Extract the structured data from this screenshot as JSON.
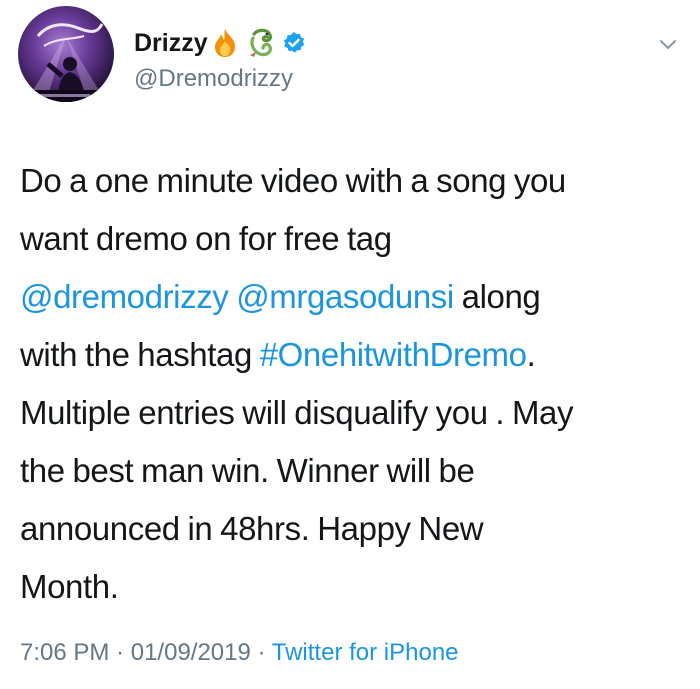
{
  "tweet": {
    "author": {
      "display_name": "Drizzy",
      "handle": "@Dremodrizzy",
      "name_emojis": [
        "fire-emoji",
        "dragon-emoji"
      ],
      "verified": true
    },
    "lines": [
      [
        "Do a one minute video with a song you"
      ],
      [
        "want dremo on for free tag"
      ],
      [
        "@dremodrizzy",
        " ",
        "@mrgasodunsi",
        " along"
      ],
      [
        "with the hashtag ",
        "#OnehitwithDremo",
        "."
      ],
      [
        "Multiple entries will disqualify you . May"
      ],
      [
        "the best man win. Winner will be"
      ],
      [
        "announced in 48hrs. Happy New"
      ],
      [
        "Month."
      ]
    ],
    "time": "7:06 PM",
    "separator": "·",
    "date": "01/09/2019",
    "source": "Twitter for iPhone"
  },
  "colors": {
    "link": "#1b95e0",
    "text": "#14171a",
    "muted": "#657786",
    "verified": "#1da1f2"
  },
  "icons": {
    "menu": "chevron-down-icon",
    "badge": "verified-badge-icon"
  }
}
